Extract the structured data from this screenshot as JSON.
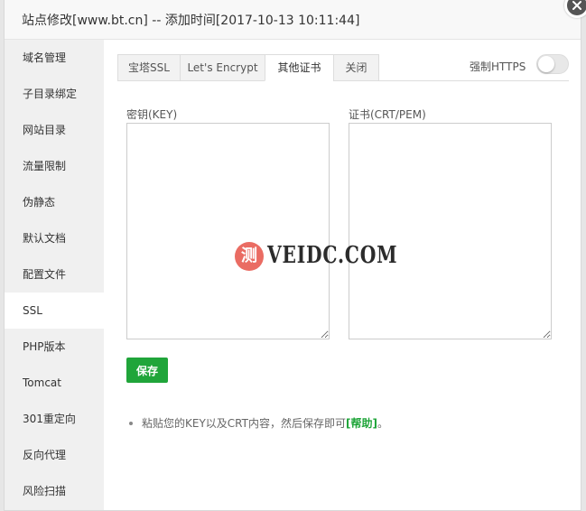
{
  "dialog": {
    "title": "站点修改[www.bt.cn] -- 添加时间[2017-10-13 10:11:44]"
  },
  "sidebar": {
    "items": [
      {
        "label": "域名管理"
      },
      {
        "label": "子目录绑定"
      },
      {
        "label": "网站目录"
      },
      {
        "label": "流量限制"
      },
      {
        "label": "伪静态"
      },
      {
        "label": "默认文档"
      },
      {
        "label": "配置文件"
      },
      {
        "label": "SSL",
        "active": true
      },
      {
        "label": "PHP版本"
      },
      {
        "label": "Tomcat"
      },
      {
        "label": "301重定向"
      },
      {
        "label": "反向代理"
      },
      {
        "label": "风险扫描"
      }
    ]
  },
  "tabs": [
    {
      "label": "宝塔SSL"
    },
    {
      "label": "Let's Encrypt"
    },
    {
      "label": "其他证书",
      "active": true
    },
    {
      "label": "关闭"
    }
  ],
  "https_toggle": {
    "label": "强制HTTPS",
    "enabled": false
  },
  "form": {
    "key_label": "密钥(KEY)",
    "key_value": "",
    "cert_label": "证书(CRT/PEM)",
    "cert_value": "",
    "save_label": "保存"
  },
  "tip": {
    "text": "粘贴您的KEY以及CRT内容，然后保存即可",
    "help_label": "[帮助]",
    "suffix": "。"
  },
  "watermark": {
    "glyph": "测",
    "text": "VEIDC.COM"
  },
  "colors": {
    "accent": "#20a53a",
    "sidebar_bg": "#f0f0f0",
    "close_button": "#555555",
    "watermark_badge": "#ea6c63"
  }
}
